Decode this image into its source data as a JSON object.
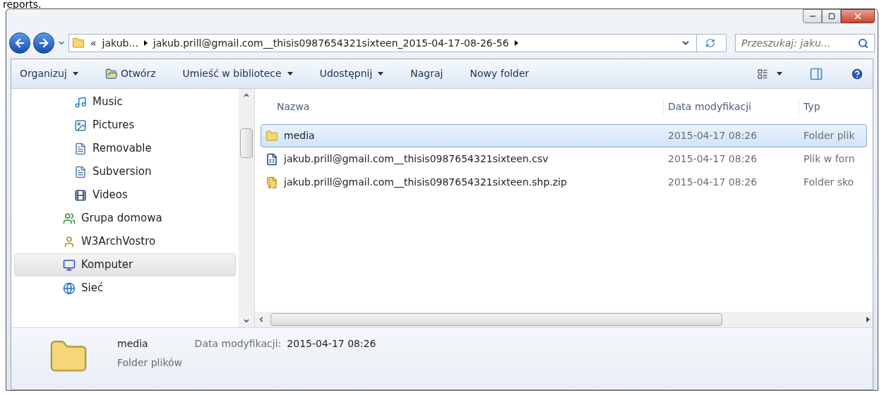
{
  "caption": "reports.",
  "address": {
    "overflow": "«",
    "crumbs": [
      "jakub...",
      "jakub.prill@gmail.com__thisis0987654321sixteen_2015-04-17-08-26-56"
    ]
  },
  "search": {
    "placeholder": "Przeszukaj: jaku..."
  },
  "commands": [
    {
      "label": "Organizuj",
      "kind": "menu"
    },
    {
      "label": "Otwórz",
      "kind": "open"
    },
    {
      "label": "Umieść w bibliotece",
      "kind": "menu"
    },
    {
      "label": "Udostępnij",
      "kind": "menu"
    },
    {
      "label": "Nagraj",
      "kind": "plain"
    },
    {
      "label": "Nowy folder",
      "kind": "plain"
    }
  ],
  "nav": {
    "library_items": [
      {
        "label": "Music",
        "kind": "music",
        "selected": false
      },
      {
        "label": "Pictures",
        "kind": "pictures",
        "selected": false
      },
      {
        "label": "Removable",
        "kind": "document",
        "selected": false
      },
      {
        "label": "Subversion",
        "kind": "document",
        "selected": false
      },
      {
        "label": "Videos",
        "kind": "video",
        "selected": false
      }
    ],
    "items": [
      {
        "label": "Grupa domowa",
        "kind": "homegroup",
        "selected": false
      },
      {
        "label": "W3ArchVostro",
        "kind": "user",
        "selected": false
      },
      {
        "label": "Komputer",
        "kind": "computer",
        "selected": true
      },
      {
        "label": "Sieć",
        "kind": "network",
        "selected": false
      }
    ]
  },
  "table": {
    "columns": [
      "Nazwa",
      "Data modyfikacji",
      "Typ"
    ],
    "rows": [
      {
        "name": "media",
        "date": "2015-04-17 08:26",
        "type": "Folder plik",
        "kind": "folder",
        "selected": true
      },
      {
        "name": "jakub.prill@gmail.com__thisis0987654321sixteen.csv",
        "date": "2015-04-17 08:26",
        "type": "Plik w forn",
        "kind": "csv",
        "selected": false
      },
      {
        "name": "jakub.prill@gmail.com__thisis0987654321sixteen.shp.zip",
        "date": "2015-04-17 08:26",
        "type": "Folder sko",
        "kind": "zip",
        "selected": false
      }
    ]
  },
  "details": {
    "name": "media",
    "type": "Folder plików",
    "date_label": "Data modyfikacji:",
    "date": "2015-04-17 08:26"
  }
}
